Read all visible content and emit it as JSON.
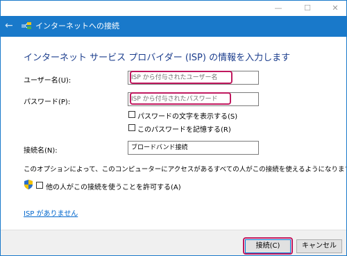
{
  "titlebar": {
    "minimize_glyph": "—",
    "maximize_glyph": "☐",
    "close_glyph": "✕"
  },
  "nav": {
    "back_glyph": "←",
    "title": "インターネットへの接続"
  },
  "heading": "インターネット サービス プロバイダー (ISP) の情報を入力します",
  "form": {
    "username": {
      "label": "ユーザー名(U):",
      "placeholder": "ISP から付与されたユーザー名"
    },
    "password": {
      "label": "パスワード(P):",
      "placeholder": "ISP から付与されたパスワード"
    },
    "show_password": {
      "label": "パスワードの文字を表示する(S)",
      "checked": false
    },
    "remember_password": {
      "label": "このパスワードを記憶する(R)",
      "checked": false
    },
    "connection_name": {
      "label": "接続名(N):",
      "value": "ブロードバンド接続"
    }
  },
  "note": "このオプションによって、このコンピューターにアクセスがあるすべての人がこの接続を使えるようになります。",
  "allow_others": {
    "label": "他の人がこの接続を使うことを許可する(A)",
    "checked": false
  },
  "no_isp_link": "ISP がありません",
  "buttons": {
    "connect": "接続(C)",
    "cancel": "キャンセル"
  },
  "colors": {
    "accent": "#1979ca",
    "highlight": "#c0185e",
    "heading": "#1a3c8c",
    "link": "#0066cc"
  }
}
